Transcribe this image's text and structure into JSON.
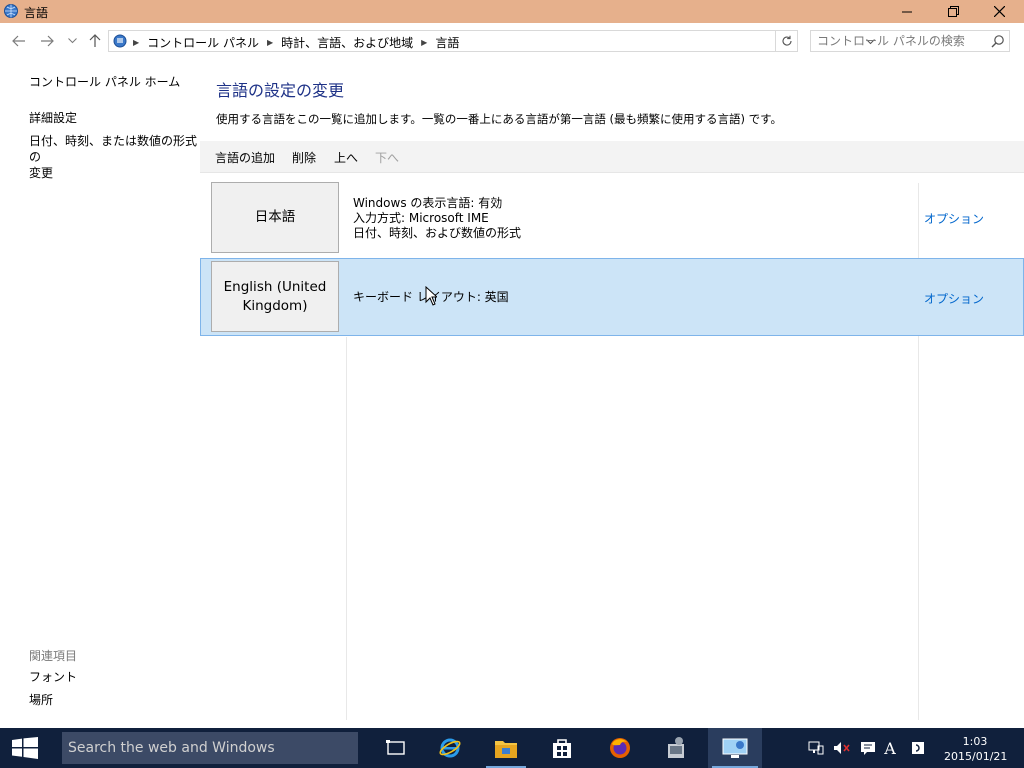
{
  "window": {
    "title": "言語"
  },
  "address": {
    "breadcrumbs": [
      "コントロール パネル",
      "時計、言語、および地域",
      "言語"
    ],
    "search_placeholder": "コントロール パネルの検索"
  },
  "sidebar": {
    "home": "コントロール パネル ホーム",
    "advanced": "詳細設定",
    "datetime_line1": "日付、時刻、または数値の形式の",
    "datetime_line2": "変更",
    "related_header": "関連項目",
    "fonts": "フォント",
    "location": "場所"
  },
  "main": {
    "heading": "言語の設定の変更",
    "description": "使用する言語をこの一覧に追加します。一覧の一番上にある言語が第一言語 (最も頻繁に使用する言語) です。",
    "toolbar": {
      "add": "言語の追加",
      "remove": "削除",
      "up": "上へ",
      "down": "下へ"
    },
    "languages": [
      {
        "name": "日本語",
        "details": [
          "Windows の表示言語: 有効",
          "入力方式: Microsoft IME",
          "日付、時刻、および数値の形式"
        ],
        "options": "オプション",
        "selected": false
      },
      {
        "name_line1": "English (United",
        "name_line2": "Kingdom)",
        "details": [
          "キーボード レイアウト: 英国"
        ],
        "options": "オプション",
        "selected": true
      }
    ]
  },
  "taskbar": {
    "search_placeholder": "Search the web and Windows",
    "ime_indicator": "A",
    "time": "1:03",
    "date": "2015/01/21"
  },
  "colors": {
    "titlebar": "#e6b08c",
    "heading": "#1e3287",
    "link": "#0066cc",
    "selection": "#cce4f7",
    "taskbar": "#10203c"
  }
}
